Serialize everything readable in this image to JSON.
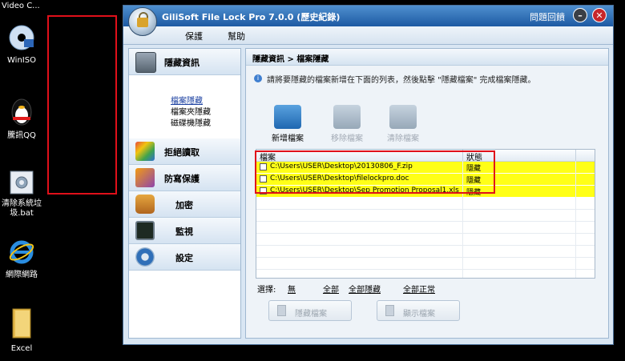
{
  "desktop": {
    "top_label": "Video C...",
    "icons": [
      {
        "label": "WinISO",
        "icon": "disc-icon"
      },
      {
        "label": "騰訊QQ",
        "icon": "qq-penguin-icon"
      },
      {
        "label": "清除系統垃\n圾.bat",
        "icon": "batch-file-icon"
      },
      {
        "label": "網際網路",
        "icon": "ie-icon"
      },
      {
        "label": "Excel",
        "icon": "folder-icon"
      }
    ]
  },
  "window": {
    "title": "GiliSoft File Lock Pro 7.0.0 (歷史紀錄)",
    "title_right": "問題回饋"
  },
  "menu": [
    "保護",
    "幫助"
  ],
  "nav": {
    "items": [
      {
        "label": "隱藏資訊",
        "icon": "safe-icon"
      },
      {
        "label": "拒絕讀取",
        "icon": "pencils-icon"
      },
      {
        "label": "防寫保護",
        "icon": "pen-icon"
      },
      {
        "label": "加密",
        "icon": "lock-icon"
      },
      {
        "label": "監視",
        "icon": "monitor-icon"
      },
      {
        "label": "設定",
        "icon": "gear-icon"
      }
    ],
    "sub_items": [
      "檔案隱藏",
      "檔案夾隱藏",
      "磁碟機隱藏"
    ]
  },
  "main": {
    "breadcrumb": "隱藏資訊 > 檔案隱藏",
    "info": "請將要隱藏的檔案新增在下面的列表，然後點擊 \"隱藏檔案\" 完成檔案隱藏。",
    "tools": [
      "新增檔案",
      "移除檔案",
      "清除檔案"
    ],
    "table": {
      "headers": [
        "檔案",
        "狀態"
      ],
      "rows": [
        {
          "path": "C:\\Users\\USER\\Desktop\\20130806_F.zip",
          "status": "隱藏"
        },
        {
          "path": "C:\\Users\\USER\\Desktop\\filelockpro.doc",
          "status": "隱藏"
        },
        {
          "path": "C:\\Users\\USER\\Desktop\\Sep Promotion Proposal1.xls",
          "status": "隱藏"
        }
      ]
    },
    "select_label": "選擇:",
    "select_options": [
      "無",
      "全部",
      "全部隱藏",
      "全部正常"
    ],
    "buttons": [
      "隱藏檔案",
      "顯示檔案"
    ]
  },
  "colors": {
    "highlight": "#ffff17",
    "annotation_red": "#e0101a",
    "title_blue": "#1d5aa3"
  }
}
